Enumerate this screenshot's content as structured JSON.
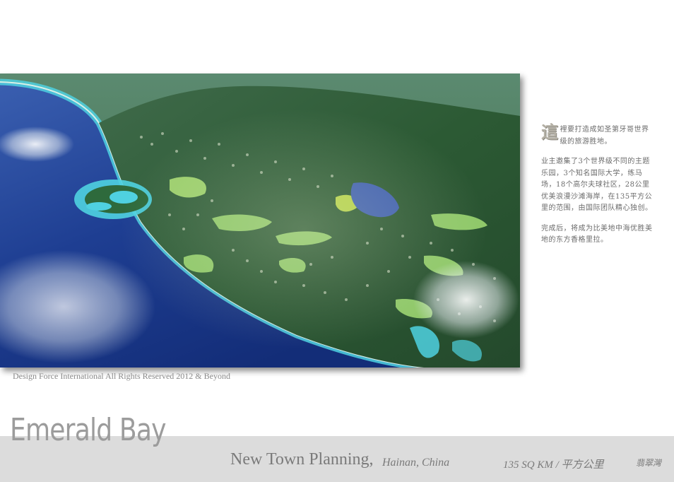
{
  "side_text": {
    "dropcap": "這",
    "intro": "裡要打造成如圣第牙哥世界级的旅游胜地。",
    "paragraph_2": "业主邀集了3个世界级不同的主题乐园，3个知名国际大学，练马场，18个高尔夫球社区，28公里优美浪漫沙滩海岸，在135平方公里的范围，由国际团队精心独创。",
    "paragraph_3": "完成后，将成为比美地中海优胜美地的东方香格里拉。"
  },
  "copyright": "Design Force International All Rights Reserved 2012 & Beyond",
  "footer": {
    "brand": "Emerald Bay",
    "project_type": "New Town Planning,",
    "location": "Hainan, China",
    "area": "135 SQ KM / 平方公里",
    "name_cn": "翡翠灣"
  },
  "colors": {
    "band": "#dcdcdc",
    "text_gray": "#7a7a7a",
    "ocean": "#1d3d8c",
    "land": "#2d5a2e"
  }
}
